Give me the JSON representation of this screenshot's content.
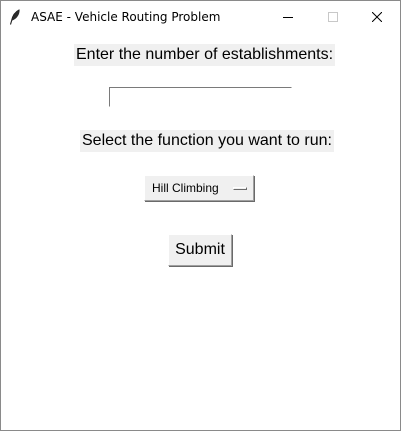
{
  "window": {
    "title": "ASAE - Vehicle Routing Problem",
    "app_icon": "feather-icon",
    "controls": {
      "minimize_icon": "minimize-icon",
      "maximize_icon": "maximize-icon",
      "close_icon": "close-icon"
    }
  },
  "form": {
    "establishments_label": "Enter the number of establishments:",
    "establishments_value": "",
    "function_label": "Select the function you want to run:",
    "function_selected": "Hill Climbing",
    "submit_label": "Submit"
  },
  "colors": {
    "label_background": "#f0f0f0",
    "window_background": "#ffffff"
  }
}
